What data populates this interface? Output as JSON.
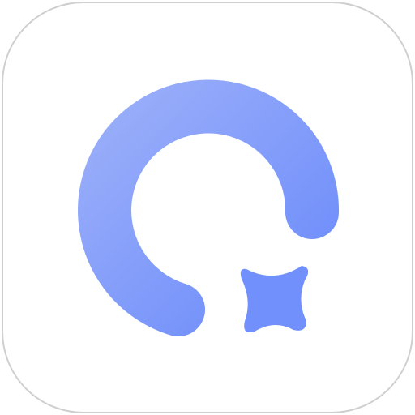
{
  "icon": {
    "name": "app-logo-icon",
    "description_shape": "open-ring-with-sparkle",
    "colors": {
      "background": "#ffffff",
      "border": "#cfcfcf",
      "gradient_start": "#9aaef9",
      "gradient_end": "#6c8cfb",
      "sparkle": "#7190fb"
    }
  }
}
